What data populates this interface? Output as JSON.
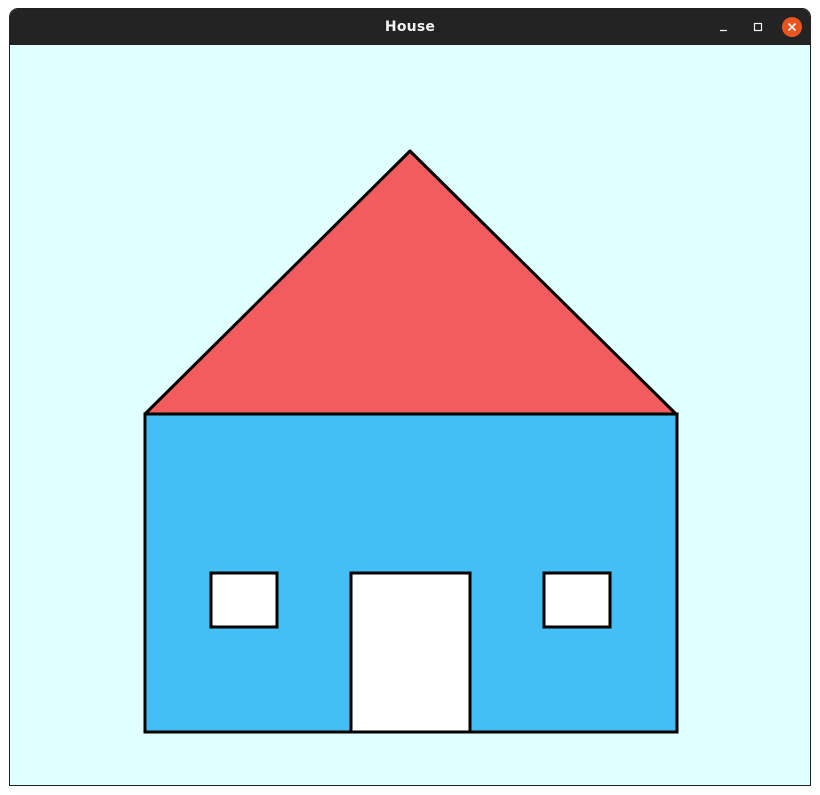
{
  "window": {
    "title": "House",
    "controls": [
      "minimize",
      "maximize",
      "close"
    ]
  },
  "drawing": {
    "background_color": "#e0ffff",
    "shapes": {
      "roof": {
        "fill": "#f25c5e",
        "stroke": "#000000"
      },
      "wall": {
        "fill": "#43bff5",
        "stroke": "#000000"
      },
      "door": {
        "fill": "#ffffff",
        "stroke": "#000000"
      },
      "left_window": {
        "fill": "#ffffff",
        "stroke": "#000000"
      },
      "right_window": {
        "fill": "#ffffff",
        "stroke": "#000000"
      }
    }
  },
  "colors": {
    "titlebar": "#232323",
    "close_button": "#e95420"
  }
}
